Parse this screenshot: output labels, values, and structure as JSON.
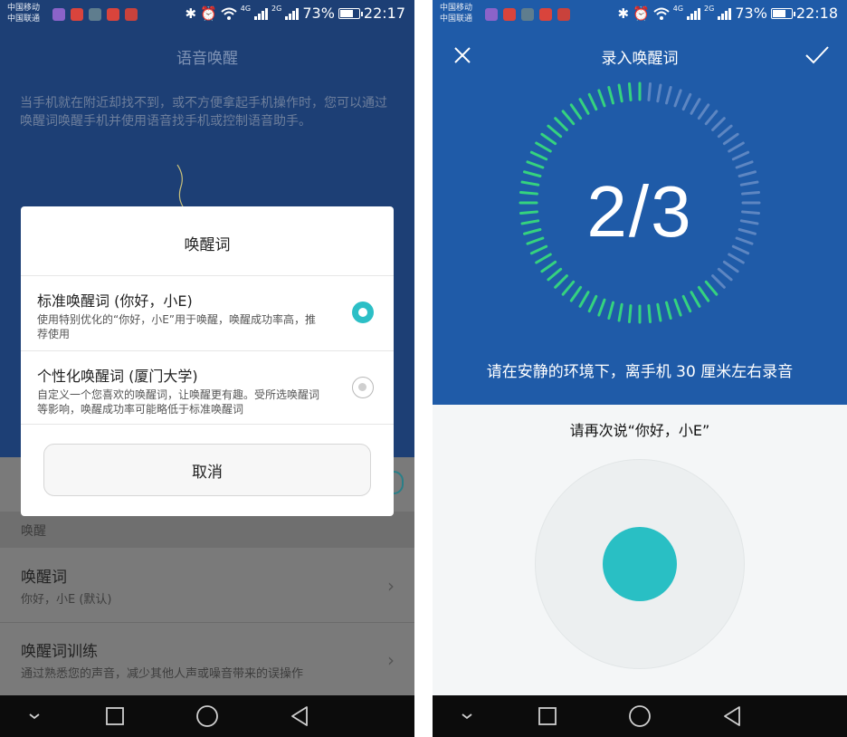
{
  "colors": {
    "left_bg": "#1d3f75",
    "right_header_bg": "#1f5ba8",
    "accent_teal": "#2cbfc6",
    "ring_active": "#35d27f",
    "ring_inactive": "#5d86c2"
  },
  "left_screen": {
    "status_bar": {
      "carrier_1": "中国移动",
      "carrier_2": "中国联通",
      "net_1": "4G",
      "net_2": "2G",
      "battery": "73%",
      "time": "22:17"
    },
    "title": "语音唤醒",
    "description": "当手机就在附近却找不到，或不方便拿起手机操作时，您可以通过唤醒词唤醒手机并使用语音找手机或控制语音助手。",
    "section_label": "唤醒",
    "settings": [
      {
        "title": "唤醒词",
        "subtitle": "你好，小E (默认)"
      },
      {
        "title": "唤醒词训练",
        "subtitle": "通过熟悉您的声音，减少其他人声或噪音带来的误操作"
      }
    ],
    "dialog": {
      "title": "唤醒词",
      "options": [
        {
          "title": "标准唤醒词 (你好，小E)",
          "description": "使用特别优化的“你好，小E”用于唤醒，唤醒成功率高，推荐使用",
          "selected": true
        },
        {
          "title": "个性化唤醒词 (厦门大学)",
          "description": "自定义一个您喜欢的唤醒词，让唤醒更有趣。受所选唤醒词等影响，唤醒成功率可能略低于标准唤醒词",
          "selected": false
        }
      ],
      "cancel_label": "取消"
    },
    "nav_icons": [
      "chevron-down-icon",
      "square-icon",
      "circle-icon",
      "back-triangle-icon"
    ]
  },
  "right_screen": {
    "status_bar": {
      "carrier_1": "中国移动",
      "carrier_2": "中国联通",
      "net_1": "4G",
      "net_2": "2G",
      "battery": "73%",
      "time": "22:18"
    },
    "title": "录入唤醒词",
    "progress_text": "2/3",
    "progress_fraction": 0.62,
    "instruction": "请在安静的环境下，离手机 30 厘米左右录音",
    "prompt": "请再次说“你好，小E”",
    "nav_icons": [
      "chevron-down-icon",
      "square-icon",
      "circle-icon",
      "back-triangle-icon"
    ]
  }
}
